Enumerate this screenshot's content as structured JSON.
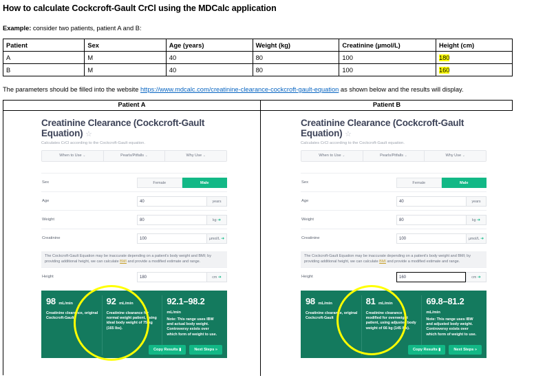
{
  "document": {
    "title": "How to calculate Cockcroft-Gault CrCl using the MDCalc application",
    "example_bold": "Example:",
    "example_rest": " consider two patients, patient A and B:",
    "sentence_before": "The parameters should be filled into the website ",
    "link_text": "https://www.mdcalc.com/creatinine-clearance-cockcroft-gault-equation",
    "sentence_after": " as shown below and the results will display."
  },
  "param_table": {
    "headers": [
      "Patient",
      "Sex",
      "Age (years)",
      "Weight (kg)",
      "Creatinine (µmol/L)",
      "Height (cm)"
    ],
    "rows": [
      {
        "patient": "A",
        "sex": "M",
        "age": "40",
        "weight": "80",
        "creatinine": "100",
        "height": "180"
      },
      {
        "patient": "B",
        "sex": "M",
        "age": "40",
        "weight": "80",
        "creatinine": "100",
        "height": "160"
      }
    ],
    "highlight_color": "#ffff00"
  },
  "frame": {
    "header_a": "Patient A",
    "header_b": "Patient B"
  },
  "calculator": {
    "title": "Creatinine Clearance (Cockcroft-Gault Equation)",
    "star_icon": "☆",
    "subtitle": "Calculates CrCl according to the Cockcroft-Gault equation.",
    "tabs": [
      {
        "label": "When to Use",
        "caret": "⌄"
      },
      {
        "label": "Pearls/Pitfalls",
        "caret": "⌄"
      },
      {
        "label": "Why Use",
        "caret": "⌄"
      }
    ],
    "sex": {
      "label": "Sex",
      "options": [
        "Female",
        "Male"
      ],
      "selected": "Male"
    },
    "notice_before": "The Cockcroft-Gault Equation may be inaccurate depending on a patient's body weight and BMI; by providing additional height, we can calculate ",
    "notice_link": "BMI",
    "notice_after": " and provide a modified estimate and range.",
    "buttons": {
      "copy": "Copy Results",
      "copy_icon": "📋",
      "next": "Next Steps",
      "next_icon": "»"
    },
    "accent_green": "#12b886",
    "result_green": "#147a5e"
  },
  "patient_a": {
    "fields": [
      {
        "label": "Age",
        "value": "40",
        "unit": "years",
        "swap": false
      },
      {
        "label": "Weight",
        "value": "80",
        "unit": "kg",
        "swap": true
      },
      {
        "label": "Creatinine",
        "value": "100",
        "unit": "µmol/L",
        "swap": true
      }
    ],
    "height": {
      "label": "Height",
      "value": "180",
      "unit": "cm",
      "swap": true,
      "focused": false
    },
    "results": {
      "col1_value": "98",
      "col1_unit": "mL/min",
      "col1_text": "Creatinine clearance, original Cockcroft-Gault",
      "col2_value": "92",
      "col2_unit": "mL/min",
      "col2_text": "Creatinine clearance for normal weight patient, using ideal body weight of 75 kg (165 lbs).",
      "col3_value": "92.1–98.2",
      "col3_unit": "mL/min",
      "col3_note": "Note: This range uses IBW and actual body weight. Controversy exists over which form of weight to use."
    }
  },
  "patient_b": {
    "fields": [
      {
        "label": "Age",
        "value": "40",
        "unit": "years",
        "swap": false
      },
      {
        "label": "Weight",
        "value": "80",
        "unit": "kg",
        "swap": true
      },
      {
        "label": "Creatinine",
        "value": "100",
        "unit": "µmol/L",
        "swap": true
      }
    ],
    "height": {
      "label": "Height",
      "value": "160",
      "unit": "cm",
      "swap": true,
      "focused": true
    },
    "results": {
      "col1_value": "98",
      "col1_unit": "mL/min",
      "col1_text": "Creatinine clearance, original Cockcroft-Gault",
      "col2_value": "81",
      "col2_unit": "mL/min",
      "col2_text": "Creatinine clearance modified for overweight patient, using adjusted body weight of 66 kg (145 lbs).",
      "col3_value": "69.8–81.2",
      "col3_unit": "mL/min",
      "col3_note": "Note: This range uses IBW and adjusted body weight. Controversy exists over which form of weight to use."
    }
  }
}
